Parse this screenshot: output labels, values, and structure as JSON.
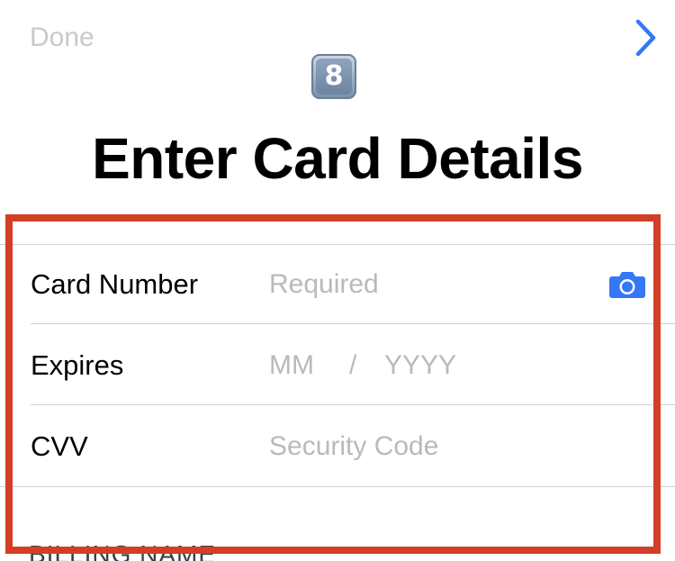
{
  "nav": {
    "done_label": "Done",
    "next_icon": "chevron-right-icon"
  },
  "header": {
    "badge_icon": "keycap-digit-eight",
    "badge_text": "8",
    "title": "Enter Card Details"
  },
  "form": {
    "card_number": {
      "label": "Card Number",
      "placeholder": "Required",
      "value": ""
    },
    "expires": {
      "label": "Expires",
      "month_placeholder": "MM",
      "separator": "/",
      "year_placeholder": "YYYY"
    },
    "cvv": {
      "label": "CVV",
      "placeholder": "Security Code",
      "value": ""
    },
    "camera_icon": "camera-icon"
  },
  "billing": {
    "section_header": "BILLING NAME"
  },
  "colors": {
    "accent": "#3478f6",
    "highlight": "#d23f26",
    "placeholder": "#b9b9be",
    "done_disabled": "#c9c9cc"
  }
}
